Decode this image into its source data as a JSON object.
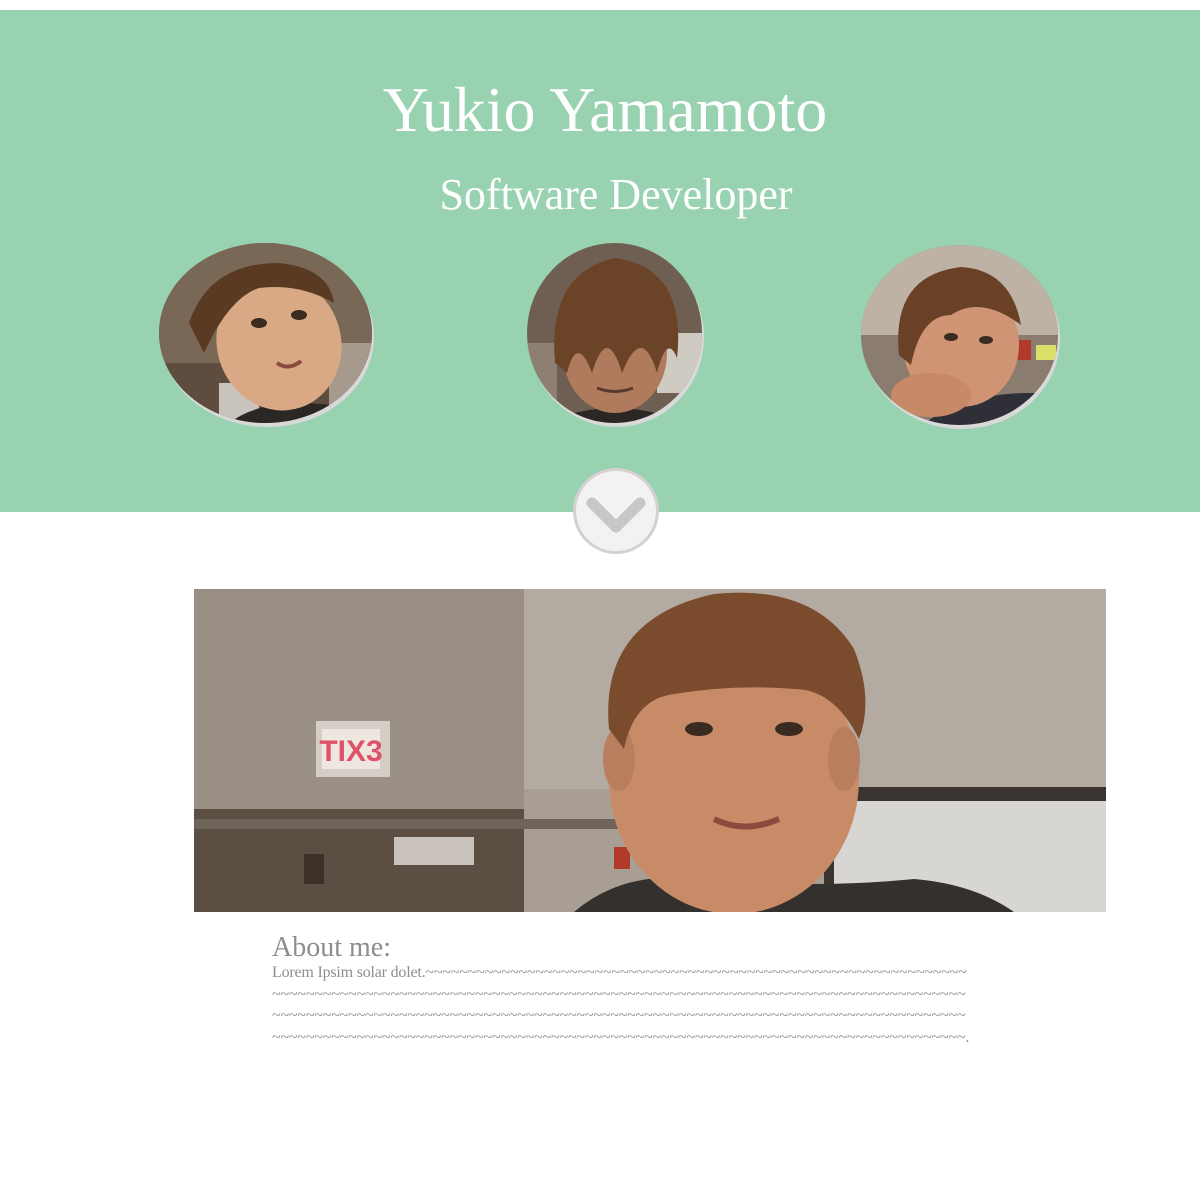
{
  "hero": {
    "name": "Yukio Yamamoto",
    "role": "Software Developer",
    "background_color": "#99d2b0",
    "text_color": "#ffffff"
  },
  "avatars": [
    {
      "icon": "portrait-photo",
      "description": "tilted head selfie"
    },
    {
      "icon": "portrait-photo",
      "description": "hair over face selfie"
    },
    {
      "icon": "portrait-photo",
      "description": "chin on fist selfie"
    }
  ],
  "scroll_button": {
    "icon": "chevron-down-icon",
    "background_color": "#f3f1f1",
    "border_color": "#d3d1d1",
    "chevron_color": "#c8c6c6"
  },
  "banner": {
    "icon": "banner-photo",
    "exit_sign_text": "TIX3"
  },
  "about": {
    "title": "About me:",
    "text": "Lorem Ipsim solar dolet.~~~~~~~~~~~~~~~~~~~~~~~~~~~~~~~~~~~~~~~~~~~~~~~~~~~~~~~~~~~~~~~~~~~~~~~~~~~~~~~~~~~~~~~~~~~~~~~~~~~~~~~~~~~~~~~~~~~~~~~~~~~~~~~~~~~~~~~~~~~~~~~~~~~~~~~~~~~~~~~~~~~~~~~~~~~~~~~~~~~~~~~~~~~~~~~~~~~~~~~~~~~~~~~~~~~~~~~~~~~~~~~~~~~~~~~~~~~~~~~~~~~~~~~~~~~~~~~~~~~~~~~~~~~~~~~~~~~~~~~~~~~~~~~~~~~~~~~~~~~~~~~~~~~~~~.",
    "text_color": "#8d8d8d"
  }
}
